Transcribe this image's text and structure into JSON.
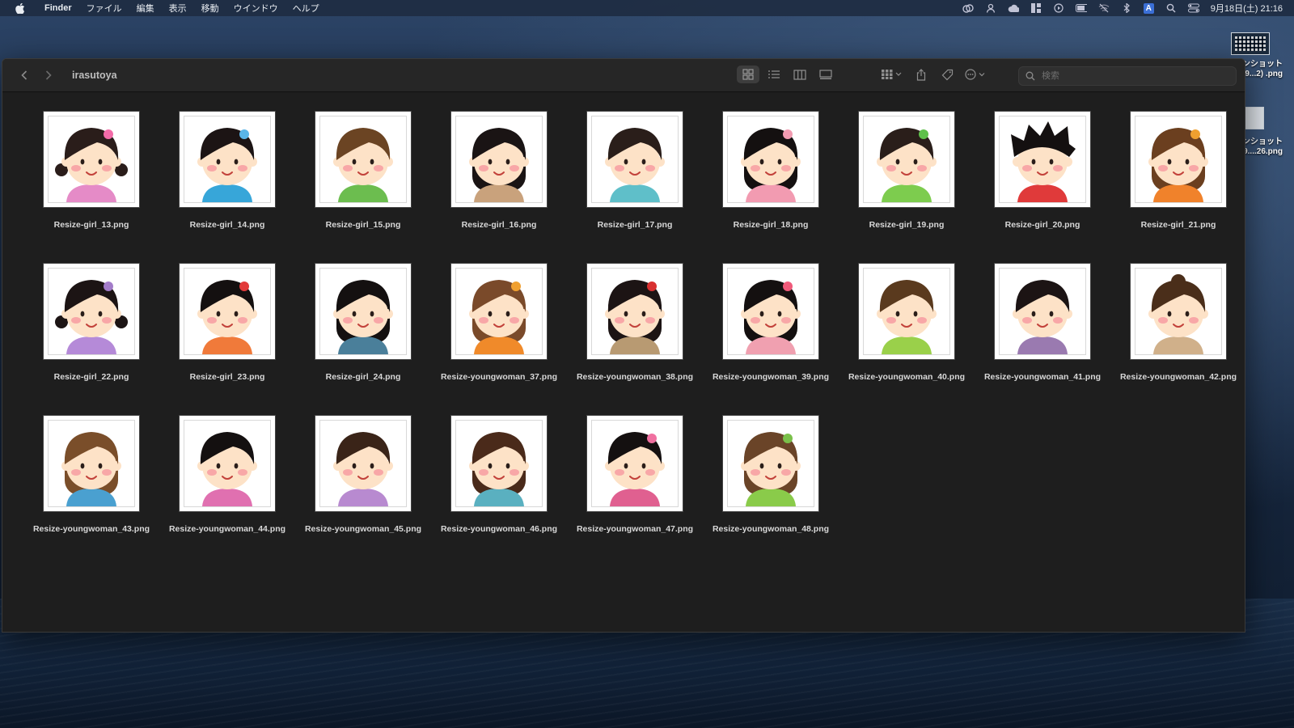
{
  "menubar": {
    "app_name": "Finder",
    "items": [
      "ファイル",
      "編集",
      "表示",
      "移動",
      "ウインドウ",
      "ヘルプ"
    ],
    "status_icons": [
      "creative-cloud-icon",
      "user-icon",
      "cloud-icon",
      "app-grid-icon",
      "play-icon",
      "battery-icon",
      "wifi-off-icon",
      "bluetooth-icon",
      "input-source-icon",
      "spotlight-icon",
      "control-center-icon"
    ],
    "input_source": "A",
    "clock": "9月18日(土) 21:16"
  },
  "desktop": {
    "icons": [
      {
        "label_line1": "ンショット",
        "label_line2": "9...2) .png"
      },
      {
        "label_line1": "ンショット",
        "label_line2": "9....26.png"
      }
    ]
  },
  "window": {
    "title": "irasutoya",
    "search_placeholder": "検索"
  },
  "colors": {
    "window_bg": "#1e1e1e",
    "toolbar_bg": "#262626"
  },
  "files": [
    {
      "name": "Resize-girl_13.png",
      "hair": "#2a1d1a",
      "cloth": "#e58bc7",
      "skin": "#fde2c7",
      "accent": "#f36ba8",
      "style": "pigtail"
    },
    {
      "name": "Resize-girl_14.png",
      "hair": "#1c1414",
      "cloth": "#37a6d9",
      "skin": "#fde2c7",
      "accent": "#5ab5e8",
      "style": "bob"
    },
    {
      "name": "Resize-girl_15.png",
      "hair": "#6b4423",
      "cloth": "#6cbd4f",
      "skin": "#fde2c7",
      "accent": "",
      "style": "bob"
    },
    {
      "name": "Resize-girl_16.png",
      "hair": "#1a1414",
      "cloth": "#c9a27c",
      "skin": "#fde2c7",
      "accent": "",
      "style": "long"
    },
    {
      "name": "Resize-girl_17.png",
      "hair": "#2a1e1a",
      "cloth": "#5fbfc9",
      "skin": "#fde2c7",
      "accent": "",
      "style": "short"
    },
    {
      "name": "Resize-girl_18.png",
      "hair": "#141010",
      "cloth": "#f29bb1",
      "skin": "#fde2c7",
      "accent": "#f29bb1",
      "style": "long"
    },
    {
      "name": "Resize-girl_19.png",
      "hair": "#2a1e1a",
      "cloth": "#7dcc4e",
      "skin": "#fde2c7",
      "accent": "#5ec04a",
      "style": "short"
    },
    {
      "name": "Resize-girl_20.png",
      "hair": "#141010",
      "cloth": "#e03a3a",
      "skin": "#fde2c7",
      "accent": "",
      "style": "spiky"
    },
    {
      "name": "Resize-girl_21.png",
      "hair": "#6b3f1f",
      "cloth": "#f0822b",
      "skin": "#fde2c7",
      "accent": "#f0a030",
      "style": "curly"
    },
    {
      "name": "Resize-girl_22.png",
      "hair": "#1c1414",
      "cloth": "#b58ad8",
      "skin": "#fde2c7",
      "accent": "#a37cc9",
      "style": "pigtail"
    },
    {
      "name": "Resize-girl_23.png",
      "hair": "#141010",
      "cloth": "#f07a3a",
      "skin": "#fde2c7",
      "accent": "#e23a3a",
      "style": "bob"
    },
    {
      "name": "Resize-girl_24.png",
      "hair": "#141010",
      "cloth": "#4a7f9a",
      "skin": "#fde2c7",
      "accent": "",
      "style": "long"
    },
    {
      "name": "Resize-youngwoman_37.png",
      "hair": "#7a4a2a",
      "cloth": "#f08a2a",
      "skin": "#fde2c7",
      "accent": "#f0a030",
      "style": "long"
    },
    {
      "name": "Resize-youngwoman_38.png",
      "hair": "#1c1414",
      "cloth": "#b89a72",
      "skin": "#fde2c7",
      "accent": "#d83030",
      "style": "long"
    },
    {
      "name": "Resize-youngwoman_39.png",
      "hair": "#141010",
      "cloth": "#f0a0b0",
      "skin": "#fde2c7",
      "accent": "#f05a7a",
      "style": "long"
    },
    {
      "name": "Resize-youngwoman_40.png",
      "hair": "#5a3a1e",
      "cloth": "#9ad04a",
      "skin": "#fde2c7",
      "accent": "",
      "style": "bob"
    },
    {
      "name": "Resize-youngwoman_41.png",
      "hair": "#1c1414",
      "cloth": "#9a7ab0",
      "skin": "#fde2c7",
      "accent": "",
      "style": "short"
    },
    {
      "name": "Resize-youngwoman_42.png",
      "hair": "#4a2e1a",
      "cloth": "#d0b08a",
      "skin": "#fde2c7",
      "accent": "",
      "style": "bun"
    },
    {
      "name": "Resize-youngwoman_43.png",
      "hair": "#7a4e2a",
      "cloth": "#4aa0d0",
      "skin": "#fde2c7",
      "accent": "",
      "style": "curly"
    },
    {
      "name": "Resize-youngwoman_44.png",
      "hair": "#141010",
      "cloth": "#e070b0",
      "skin": "#fde2c7",
      "accent": "",
      "style": "bob"
    },
    {
      "name": "Resize-youngwoman_45.png",
      "hair": "#3a2418",
      "cloth": "#b88ad0",
      "skin": "#fde2c7",
      "accent": "",
      "style": "bob"
    },
    {
      "name": "Resize-youngwoman_46.png",
      "hair": "#4a2a1a",
      "cloth": "#5ab0c0",
      "skin": "#fde2c7",
      "accent": "",
      "style": "curly"
    },
    {
      "name": "Resize-youngwoman_47.png",
      "hair": "#141010",
      "cloth": "#e06090",
      "skin": "#fde2c7",
      "accent": "#f070a0",
      "style": "short"
    },
    {
      "name": "Resize-youngwoman_48.png",
      "hair": "#6a4428",
      "cloth": "#8acb4a",
      "skin": "#fde2c7",
      "accent": "#7ac04a",
      "style": "curly"
    }
  ]
}
